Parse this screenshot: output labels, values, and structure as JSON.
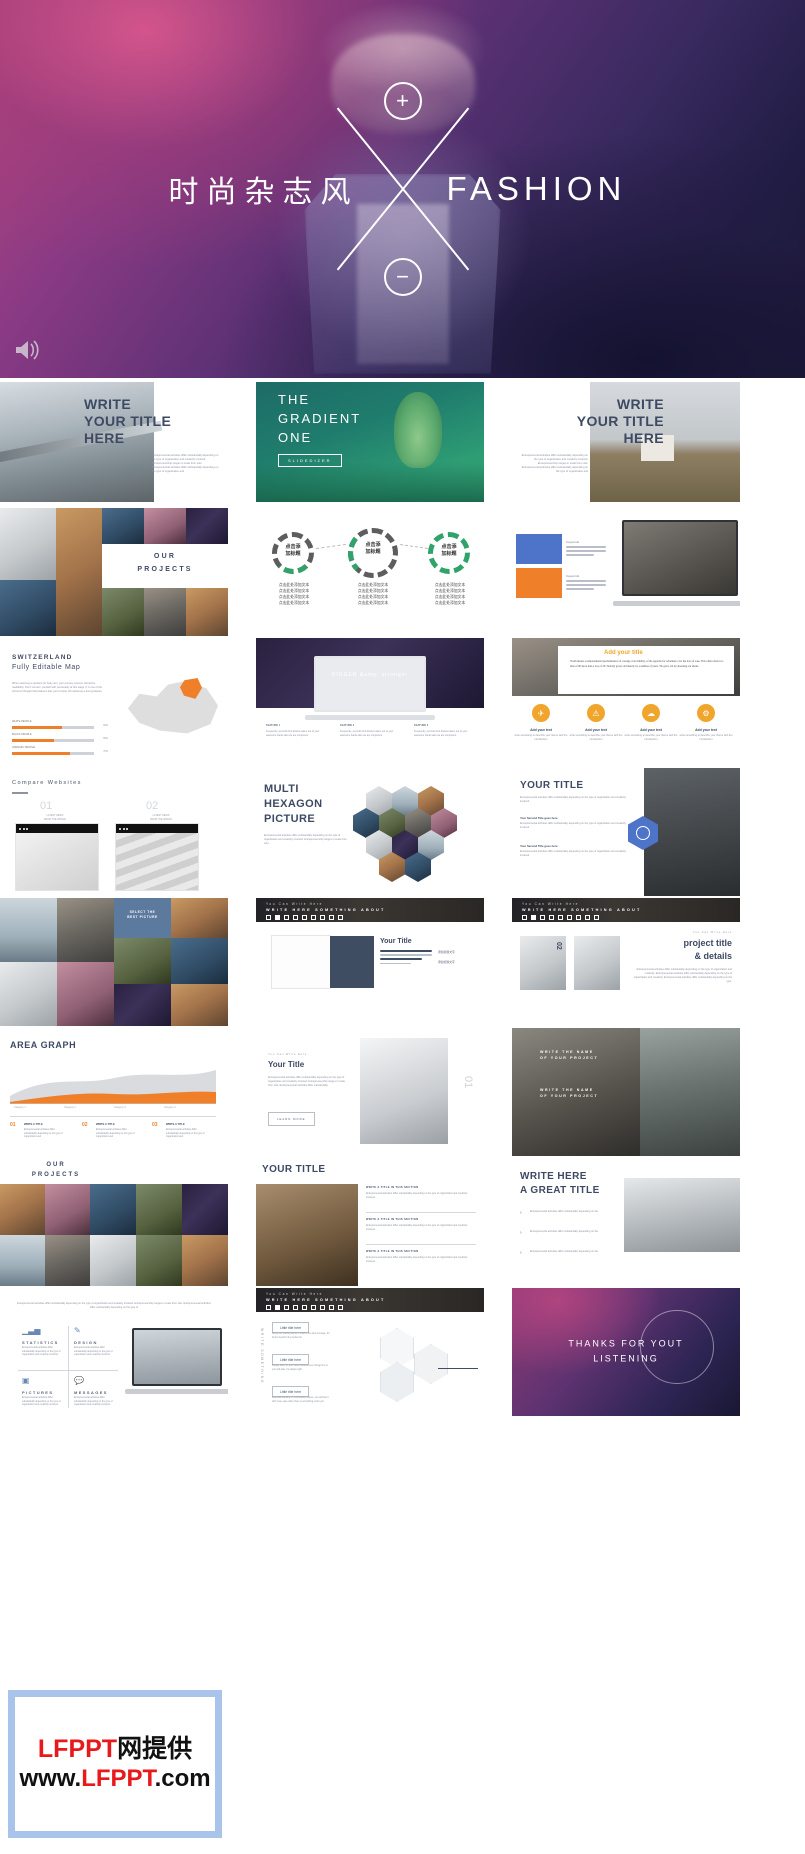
{
  "hero": {
    "title_cn": "时尚杂志风",
    "title_en": "FASHION",
    "plus_icon": "plus-icon",
    "minus_icon": "minus-icon",
    "sound_icon": "sound-icon"
  },
  "slides": {
    "write_title_here": {
      "line1": "WRITE",
      "line2": "YOUR TITLE",
      "line3": "HERE",
      "body": "Entrepreneurial activities differ substantially depending on the type of organization and creativity involved. Entrepreneurship ranges in scale from solo. Entrepreneurial activities differ substantially depending on the type of organization and"
    },
    "gradient_one": {
      "line1": "THE",
      "line2": "GRADIENT",
      "line3": "ONE",
      "button": "SLIDEDIZER"
    },
    "write_title_here_2": {
      "line1": "WRITE",
      "line2": "YOUR TITLE",
      "line3": "HERE",
      "body": "Entrepreneurial activities differ substantially depending on the type of organization and creativity involved. Entrepreneurship ranges in scale from solo. Entrepreneurial activities differ substantially depending on the type of organization and"
    },
    "our_projects": {
      "line1": "OUR",
      "line2": "PROJECTS"
    },
    "circles": {
      "c1": "点击添\n加标题",
      "c2": "点击添\n加标题",
      "c3": "点击添\n加标题",
      "text1": "点击此处添加文本",
      "text2": "点击此处添加文本",
      "text3": "点击此处添加文本"
    },
    "cards_laptop": {
      "card1": "Keywords",
      "card2": "Keywords"
    },
    "switzerland": {
      "line1": "SWITZERLAND",
      "line2": "Fully Editable Map",
      "body": "When selecting a typeface for body text, your primary concern should be readability. Don't concern yourself with personality at this stage. If in one of the school of thought that believes that you're better off mastering a few typefaces.",
      "bars": [
        {
          "label": "WHITE PEOPLE",
          "value": "60%",
          "pct": 62
        },
        {
          "label": "BLACK PEOPLE",
          "value": "50%",
          "pct": 52
        },
        {
          "label": "HISPANIC PEOPLE",
          "value": "70%",
          "pct": 72
        }
      ]
    },
    "laptop_dark": {
      "brand": "BIGGER &amp; stronger",
      "col1_title": "FEATURE 1",
      "col2_title": "FEATURE 2",
      "col3_title": "FEATURE 3",
      "col1": "Frequently, you'rebit font division taken out of your awesome hands also we are computers.",
      "col2": "Frequently, you'rebit font division taken out of your awesome hands also we are computers.",
      "col3": "Frequently, you'rebit font division taken out of your awesome hands also we are computers."
    },
    "add_your_title": {
      "title": "Add your title",
      "body": "Youth means a temperamental predominance of courage over timidity, of the appetite for adventure over the love of ease. This often exists in a man of 60 more than a boy of 20. Nobody grows old merely by a number of years. We grow old by deserting our ideals.",
      "items": [
        {
          "label": "Add your text",
          "desc": "write something to describe your theme with the introduction",
          "icon": "rocket-icon"
        },
        {
          "label": "Add your text",
          "desc": "write something to describe your theme with the introduction",
          "icon": "warning-icon"
        },
        {
          "label": "Add your text",
          "desc": "write something to describe your theme with the introduction",
          "icon": "cloud-icon"
        },
        {
          "label": "Add your text",
          "desc": "write something to describe your theme with the introduction",
          "icon": "gear-icon"
        }
      ]
    },
    "compare_websites": {
      "title": "Compare Websites",
      "n1": "01",
      "n1sub": "LATEST NEWS\nFROM THE WORLD",
      "n2": "02",
      "n2sub": "LATEST NEWS\nFROM THE WORLD"
    },
    "multi_hexagon": {
      "line1": "MULTI",
      "line2": "HEXAGON",
      "line3": "PICTURE",
      "body": "Entrepreneurial activities differ substantially depending on the type of organization and creativity involved. Entrepreneurship ranges in scale from solo."
    },
    "your_title_badge": {
      "title": "YOUR TITLE",
      "body": "Entrepreneurial activities differ substantially depending on the type of organization and creativity involved.",
      "sub1": "Your Second Title goes here",
      "sub1body": "Entrepreneurial activities differ substantially depending on the type of organization and creativity involved.",
      "sub2": "Your Second Title goes here",
      "sub2body": "Entrepreneurial activities differ substantially depending on the type of organization and creativity involved."
    },
    "mosaic_projects": {
      "badge": "SELECT THE\nBEST PICTURE"
    },
    "write_here_something": {
      "eyebrow": "You Can Write Here",
      "title": "WRITE HERE SOMETHING ABOUT"
    },
    "write_here_something_2": {
      "eyebrow": "You Can Write Here",
      "title": "WRITE HERE SOMETHING ABOUT"
    },
    "book_your_title": {
      "title": "Your Title",
      "item1": "添加标题文字",
      "item2": "添加标题文字"
    },
    "project_title": {
      "eyebrow": "You Can Write Here",
      "line1": "project title",
      "line2": "& details",
      "body": "Entrepreneurial activities differ substantially depending on the type of organization and creativity. Entrepreneurial activities differ substantially depending on the type of organization and creativity. Entrepreneurial activities differ substantially depending on the type.",
      "number": "02"
    },
    "area_graph": {
      "title": "AREA GRAPH",
      "items": [
        {
          "num": "01",
          "label": "WRITE A TITLE",
          "desc": "Entrepreneurial activities differ substantially depending on the type of organization and"
        },
        {
          "num": "02",
          "label": "WRITE A TITLE",
          "desc": "Entrepreneurial activities differ substantially depending on the type of organization and"
        },
        {
          "num": "03",
          "label": "WRITE A TITLE",
          "desc": "Entrepreneurial activities differ substantially depending on the type of organization and"
        }
      ]
    },
    "learn_more": {
      "eyebrow": "You Can Write Here",
      "title": "Your Title",
      "body": "Entrepreneurial activities differ substantially depending on the type of organization and creativity involved. Entrepreneurship ranges in scale from solo. Entrepreneurial activities differ substantially.",
      "button": "LEARN MORE",
      "number": "01"
    },
    "write_name_project": {
      "line1": "WRITE THE NAME",
      "line2": "OF YOUR PROJECT",
      "line3": "WRITE THE NAME",
      "line4": "OF YOUR PROJECT"
    },
    "our_projects_2": {
      "line1": "OUR",
      "line2": "PROJECTS"
    },
    "your_title_list": {
      "title": "YOUR TITLE",
      "items": [
        {
          "head": "WRITE A TITLE IN THIS SECTION",
          "body": "Entrepreneurial activities differ substantially depending on the type of organization and creativity involved."
        },
        {
          "head": "WRITE A TITLE IN THIS SECTION",
          "body": "Entrepreneurial activities differ substantially depending on the type of organization and creativity involved."
        },
        {
          "head": "WRITE A TITLE IN THIS SECTION",
          "body": "Entrepreneurial activities differ substantially depending on the type of organization and creativity involved."
        }
      ]
    },
    "write_here_great": {
      "line1": "WRITE HERE",
      "line2": "A GREAT TITLE",
      "items": [
        "Entrepreneurial activities differ substantially depending on the",
        "Entrepreneurial activities differ substantially depending on the",
        "Entrepreneurial activities differ substantially depending on the"
      ]
    },
    "four_icons": {
      "intro": "Entrepreneurial activities differ substantially depending on the type of organization and creativity involved. Entrepreneurship ranges in scale from solo. Entrepreneurial activities differ substantially depending on the type of",
      "items": [
        {
          "label": "STATISTICS",
          "desc": "Entrepreneurial activities differ substantially depending on the type of organization and creativity involved.",
          "icon": "chart-icon"
        },
        {
          "label": "DESIGN",
          "desc": "Entrepreneurial activities differ substantially depending on the type of organization and creativity involved.",
          "icon": "pencil-icon"
        },
        {
          "label": "PICTURES",
          "desc": "Entrepreneurial activities differ substantially depending on the type of organization and creativity involved.",
          "icon": "image-icon"
        },
        {
          "label": "MESSAGES",
          "desc": "Entrepreneurial activities differ substantially depending on the type of organization and creativity involved.",
          "icon": "chat-icon"
        }
      ]
    },
    "little_titles": {
      "eyebrow": "You Can Write Here",
      "banner": "WRITE HERE SOMETHING ABOUT",
      "t1": "Little title here",
      "t1body": "Acting out nothing borne in mind is the best leverage. It's all for myself to live better life.",
      "t2": "Little title here",
      "t2body": "Always listen to your heart because even though it's on your left side, it's always right.",
      "t3": "Little title here",
      "t3body": "Misunderstanding of comparative degree, you will feel it with more ease when there is something under you.",
      "sidevert": "WRITE SOMETHING"
    },
    "thanks": {
      "line1": "THANKS FOR YOUT",
      "line2": "LISTENING"
    }
  },
  "watermark": {
    "line1_red": "LFPPT",
    "line1_black": "网提供",
    "line2a": "www.",
    "line2b": "LFPPT",
    "line2c": ".com"
  }
}
